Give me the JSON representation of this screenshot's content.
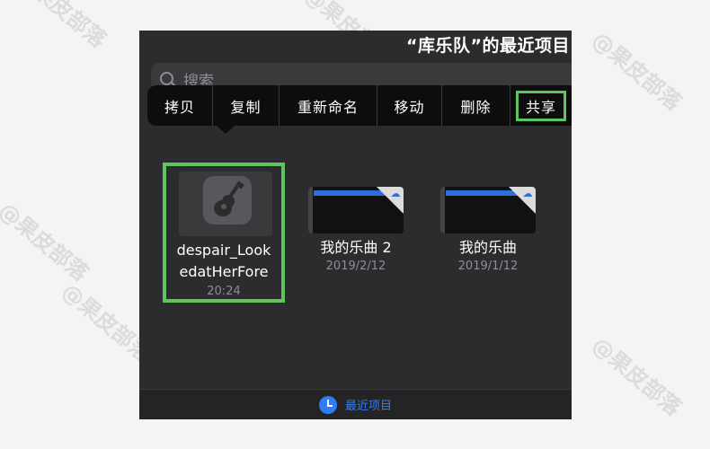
{
  "header": {
    "title": "“库乐队”的最近项目"
  },
  "search": {
    "placeholder": "搜索"
  },
  "context_menu": {
    "items": [
      "拷贝",
      "复制",
      "重新命名",
      "移动",
      "删除",
      "共享"
    ]
  },
  "files": [
    {
      "name": "despair_LookedatHerFore",
      "date": "20:24"
    },
    {
      "name": "我的乐曲 2",
      "date": "2019/2/12"
    },
    {
      "name": "我的乐曲",
      "date": "2019/1/12"
    }
  ],
  "tabbar": {
    "label": "最近项目"
  },
  "watermark": {
    "text": "@果皮部落"
  },
  "colors": {
    "highlight": "#5cc55d",
    "accent": "#2f7cf6",
    "background": "#2c2c2e",
    "menu": "#0d0d0d"
  },
  "icons": [
    "search-icon",
    "garageband-guitar-icon",
    "cloud-download-icon",
    "clock-icon"
  ]
}
